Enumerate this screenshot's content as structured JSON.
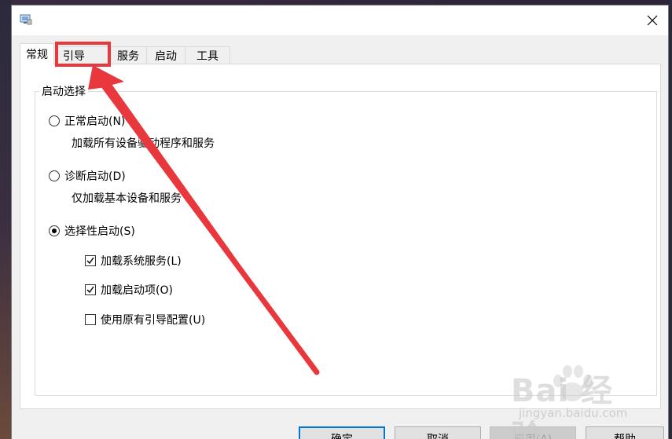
{
  "tabs": [
    {
      "label": "常规",
      "active": true
    },
    {
      "label": "引导",
      "active": false
    },
    {
      "label": "服务",
      "active": false
    },
    {
      "label": "启动",
      "active": false
    },
    {
      "label": "工具",
      "active": false
    }
  ],
  "startup_group": {
    "title": "启动选择",
    "normal": {
      "label": "正常启动(N)",
      "desc": "加载所有设备驱动程序和服务",
      "checked": false
    },
    "diagnostic": {
      "label": "诊断启动(D)",
      "desc": "仅加载基本设备和服务",
      "checked": false
    },
    "selective": {
      "label": "选择性启动(S)",
      "checked": true
    },
    "options": [
      {
        "label": "加载系统服务(L)",
        "checked": true
      },
      {
        "label": "加载启动项(O)",
        "checked": true
      },
      {
        "label": "使用原有引导配置(U)",
        "checked": false
      }
    ]
  },
  "buttons": {
    "ok": "确定",
    "cancel": "取消",
    "apply": "应用(A)",
    "help": "帮助"
  },
  "annotation": {
    "color": "#e8383d"
  },
  "watermark": {
    "brand": "Bai 经验",
    "url": "jingyan.baidu.com"
  }
}
